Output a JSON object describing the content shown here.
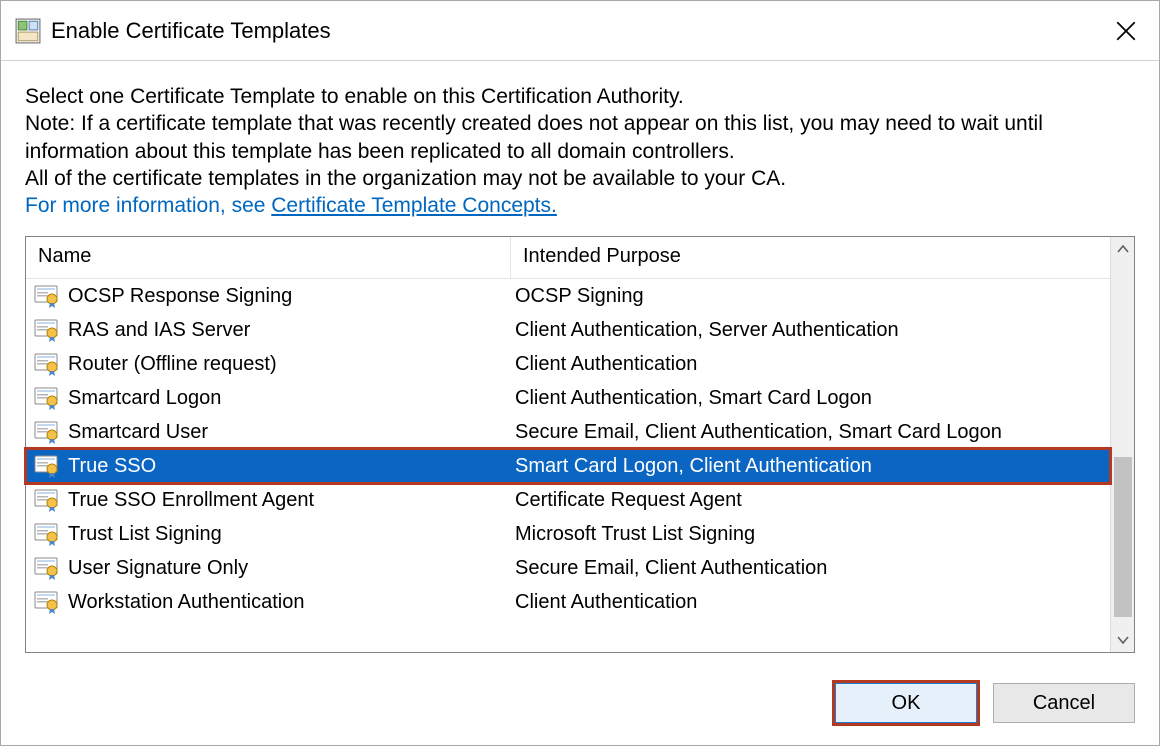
{
  "titlebar": {
    "title": "Enable Certificate Templates"
  },
  "instructions": {
    "line1": "Select one Certificate Template to enable on this Certification Authority.",
    "line2": "Note: If a certificate template that was recently created does not appear on this list, you may need to wait until information about this template has been replicated to all domain controllers.",
    "line3": "All of the certificate templates in the organization may not be available to your CA.",
    "moreinfo_prefix": "For more information, see ",
    "moreinfo_link": "Certificate Template Concepts."
  },
  "columns": {
    "name": "Name",
    "purpose": "Intended Purpose"
  },
  "rows": [
    {
      "name": "OCSP Response Signing",
      "purpose": "OCSP Signing",
      "selected": false
    },
    {
      "name": "RAS and IAS Server",
      "purpose": "Client Authentication, Server Authentication",
      "selected": false
    },
    {
      "name": "Router (Offline request)",
      "purpose": "Client Authentication",
      "selected": false
    },
    {
      "name": "Smartcard Logon",
      "purpose": "Client Authentication, Smart Card Logon",
      "selected": false
    },
    {
      "name": "Smartcard User",
      "purpose": "Secure Email, Client Authentication, Smart Card Logon",
      "selected": false
    },
    {
      "name": "True SSO",
      "purpose": "Smart Card Logon, Client Authentication",
      "selected": true
    },
    {
      "name": "True SSO Enrollment Agent",
      "purpose": "Certificate Request Agent",
      "selected": false
    },
    {
      "name": "Trust List Signing",
      "purpose": "Microsoft Trust List Signing",
      "selected": false
    },
    {
      "name": "User Signature Only",
      "purpose": "Secure Email, Client Authentication",
      "selected": false
    },
    {
      "name": "Workstation Authentication",
      "purpose": "Client Authentication",
      "selected": false
    }
  ],
  "buttons": {
    "ok": "OK",
    "cancel": "Cancel"
  },
  "icons": {
    "app": "cert-templates-icon",
    "cert": "certificate-template-icon"
  }
}
